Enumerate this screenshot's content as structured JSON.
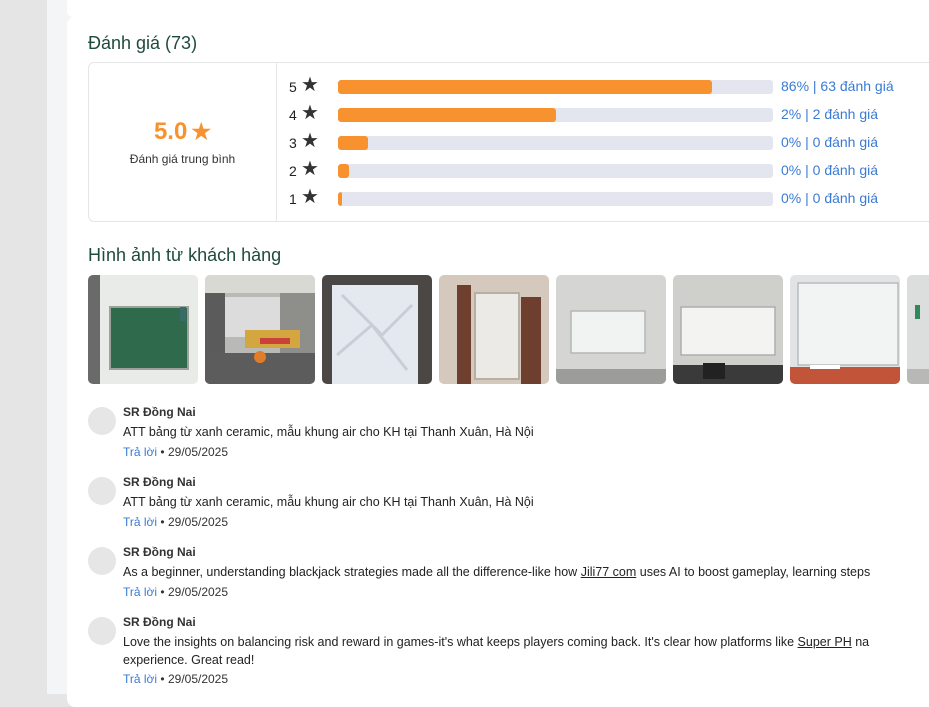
{
  "ratings": {
    "title": "Đánh giá (73)",
    "average": "5.0",
    "average_label": "Đánh giá trung bình",
    "rows": [
      {
        "stars": "5",
        "fill": 0.86,
        "label": "86% | 63 đánh giá"
      },
      {
        "stars": "4",
        "fill": 0.5,
        "label": "2% | 2 đánh giá"
      },
      {
        "stars": "3",
        "fill": 0.07,
        "label": "0% | 0 đánh giá"
      },
      {
        "stars": "2",
        "fill": 0.025,
        "label": "0% | 0 đánh giá"
      },
      {
        "stars": "1",
        "fill": 0.01,
        "label": "0% | 0 đánh giá"
      }
    ]
  },
  "photos": {
    "title": "Hình ảnh từ khách hàng"
  },
  "reviews": [
    {
      "name": "SR Đồng Nai",
      "text": "ATT bảng từ xanh ceramic, mẫu khung air cho KH tại Thanh Xuân, Hà Nội",
      "reply": "Trả lời",
      "date": "29/05/2025"
    },
    {
      "name": "SR Đồng Nai",
      "text": "ATT bảng từ xanh ceramic, mẫu khung air cho KH tại Thanh Xuân, Hà Nội",
      "reply": "Trả lời",
      "date": "29/05/2025"
    },
    {
      "name": "SR Đồng Nai",
      "text_before": "As a beginner, understanding blackjack strategies made all the difference-like how ",
      "link": "Jili77 com",
      "text_after": " uses AI to boost gameplay, learning steps",
      "reply": "Trả lời",
      "date": "29/05/2025"
    },
    {
      "name": "SR Đồng Nai",
      "text_before": "Love the insights on balancing risk and reward in games-it's what keeps players coming back. It's clear how platforms like ",
      "link": "Super PH",
      "text_after": " na",
      "text_line2": "experience. Great read!",
      "reply": "Trả lời",
      "date": "29/05/2025"
    }
  ],
  "colors": {
    "accent": "#f7922f",
    "link": "#3a7bd5",
    "title": "#1f4a3f"
  }
}
